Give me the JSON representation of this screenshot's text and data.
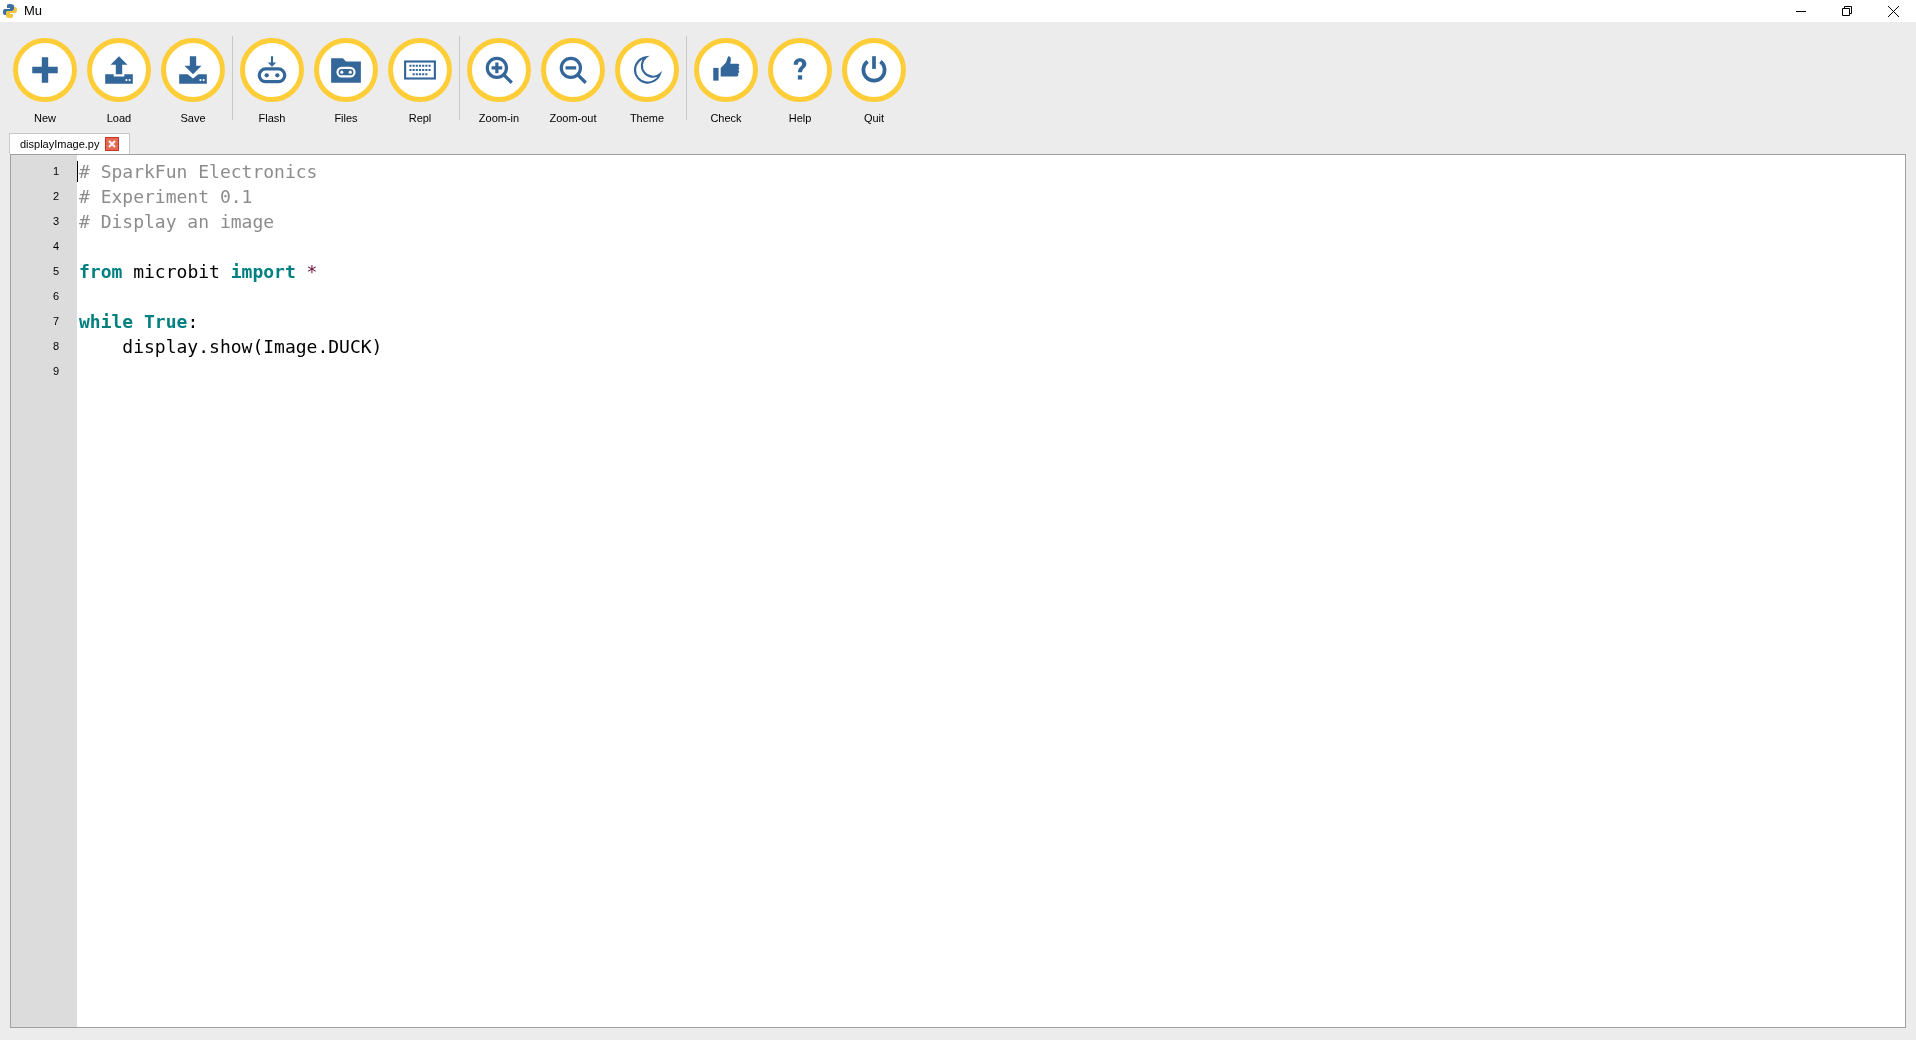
{
  "window": {
    "title": "Mu"
  },
  "toolbar": [
    {
      "label": "New"
    },
    {
      "label": "Load"
    },
    {
      "label": "Save"
    },
    {
      "label": "Flash"
    },
    {
      "label": "Files"
    },
    {
      "label": "Repl"
    },
    {
      "label": "Zoom-in"
    },
    {
      "label": "Zoom-out"
    },
    {
      "label": "Theme"
    },
    {
      "label": "Check"
    },
    {
      "label": "Help"
    },
    {
      "label": "Quit"
    }
  ],
  "tabs": [
    {
      "label": "displayImage.py",
      "selected": true
    }
  ],
  "editor": {
    "lines": [
      {
        "number": "1",
        "tokens": [
          {
            "kind": "comment",
            "text": "# SparkFun Electronics"
          }
        ]
      },
      {
        "number": "2",
        "tokens": [
          {
            "kind": "comment",
            "text": "# Experiment 0.1"
          }
        ]
      },
      {
        "number": "3",
        "tokens": [
          {
            "kind": "comment",
            "text": "# Display an image"
          }
        ]
      },
      {
        "number": "4"
      },
      {
        "number": "5",
        "tokens": [
          {
            "kind": "keyword",
            "text": "from"
          },
          {
            "kind": "plain",
            "text": " microbit "
          },
          {
            "kind": "keyword",
            "text": "import"
          },
          {
            "kind": "operator",
            "text": " *"
          }
        ]
      },
      {
        "number": "6"
      },
      {
        "number": "7",
        "tokens": [
          {
            "kind": "keyword",
            "text": "while True"
          },
          {
            "kind": "plain",
            "text": ":"
          }
        ]
      },
      {
        "number": "8",
        "tokens": [
          {
            "kind": "plain",
            "text": "    display.show(Image.DUCK)"
          }
        ]
      },
      {
        "number": "9"
      }
    ]
  }
}
